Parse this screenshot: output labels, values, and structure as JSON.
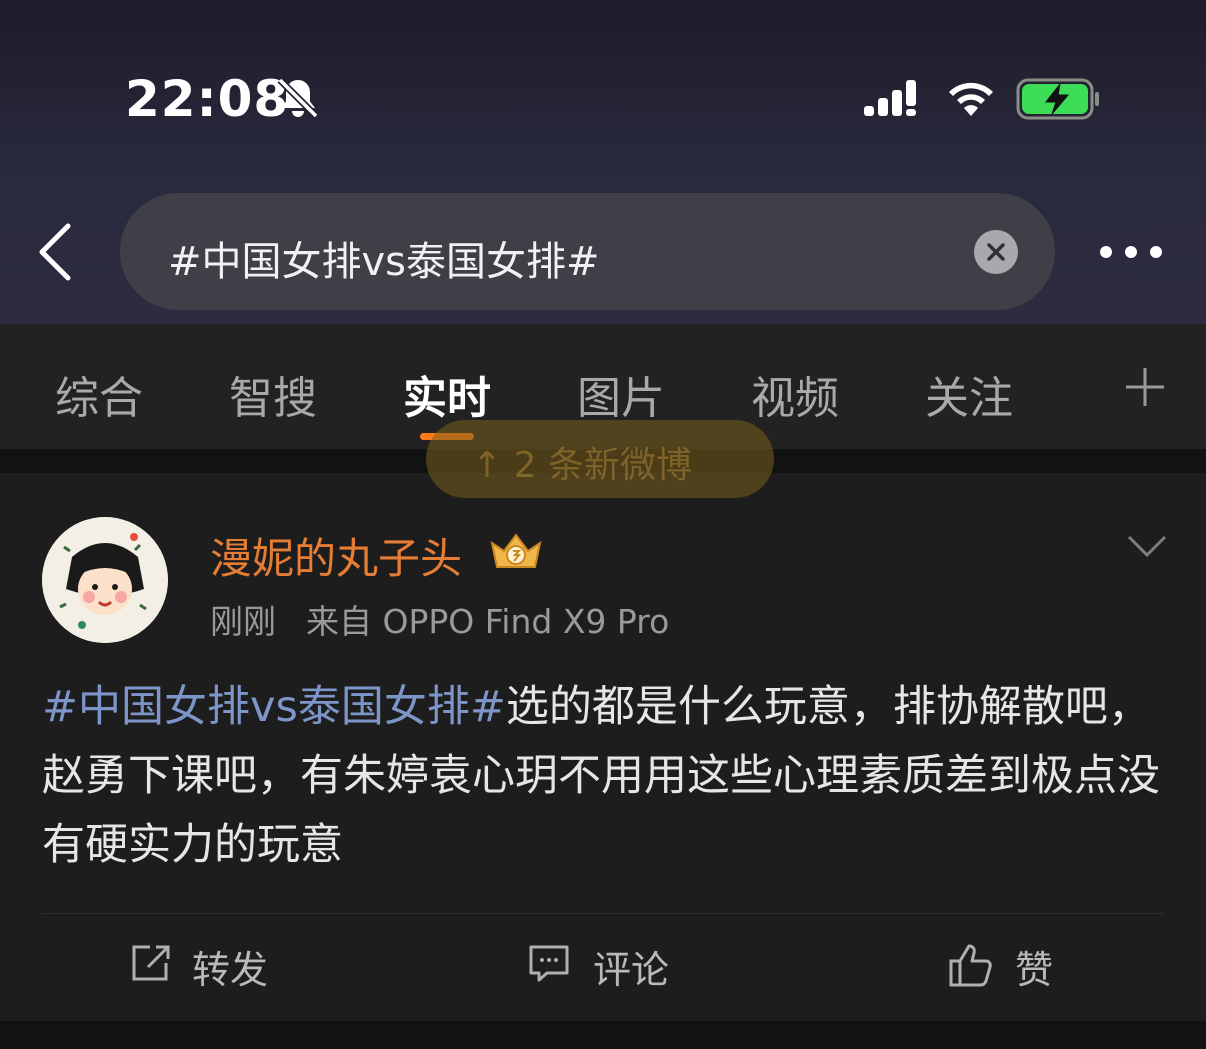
{
  "status_bar": {
    "time": "22:08",
    "icons": [
      "bell-slash-icon",
      "cellular-signal-icon",
      "wifi-icon",
      "battery-charging-icon"
    ],
    "battery_color": "#3ddc57"
  },
  "search": {
    "query": "#中国女排vs泰国女排#",
    "icons": [
      "back-icon",
      "clear-icon",
      "more-icon"
    ]
  },
  "tabs": [
    {
      "label": "综合"
    },
    {
      "label": "智搜"
    },
    {
      "label": "实时",
      "active": true
    },
    {
      "label": "图片"
    },
    {
      "label": "视频"
    },
    {
      "label": "关注"
    }
  ],
  "tab_indicator_color": "#ff7a1a",
  "new_posts_pill": "↑ 2 条新微博",
  "post": {
    "username": "漫妮的丸子头",
    "username_color": "#e57d35",
    "badge_icon": "crown-badge-icon",
    "time": "刚刚",
    "source": "来自 OPPO Find X9 Pro",
    "hashtag": "#中国女排vs泰国女排#",
    "body": "选的都是什么玩意，排协解散吧，赵勇下课吧，有朱婷袁心玥不用用这些心理素质差到极点没有硬实力的玩意",
    "hashtag_color": "#7d95c9"
  },
  "actions": {
    "repost": "转发",
    "comment": "评论",
    "like": "赞"
  }
}
